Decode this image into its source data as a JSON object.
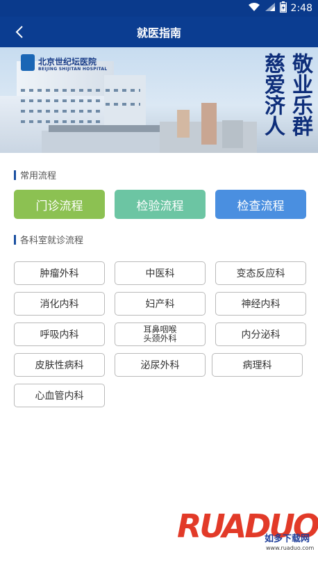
{
  "status": {
    "time": "2:48"
  },
  "appbar": {
    "title": "就医指南"
  },
  "banner": {
    "hospital_name": "北京世纪坛医院",
    "hospital_name_en": "BEIJING SHIJITAN HOSPITAL",
    "slogan_left": "慈爱济人",
    "slogan_right": "敬业乐群"
  },
  "common": {
    "heading": "常用流程",
    "buttons": [
      {
        "label": "门诊流程",
        "color": "#8cc152"
      },
      {
        "label": "检验流程",
        "color": "#6cc5a3"
      },
      {
        "label": "检查流程",
        "color": "#4a8fe0"
      }
    ]
  },
  "departments": {
    "heading": "各科室就诊流程",
    "items": [
      "肿瘤外科",
      "中医科",
      "变态反应科",
      "消化内科",
      "妇产科",
      "神经内科",
      "呼吸内科",
      "耳鼻咽喉\n头颈外科",
      "内分泌科",
      "皮肤性病科",
      "泌尿外科",
      "病理科",
      "心血管内科"
    ]
  },
  "watermark": {
    "brand": "RUADUO",
    "cn": "如多下载网",
    "url": "www.ruaduo.com"
  },
  "colors": {
    "primary": "#0b3d91",
    "status_bar": "#0a3a8c"
  }
}
